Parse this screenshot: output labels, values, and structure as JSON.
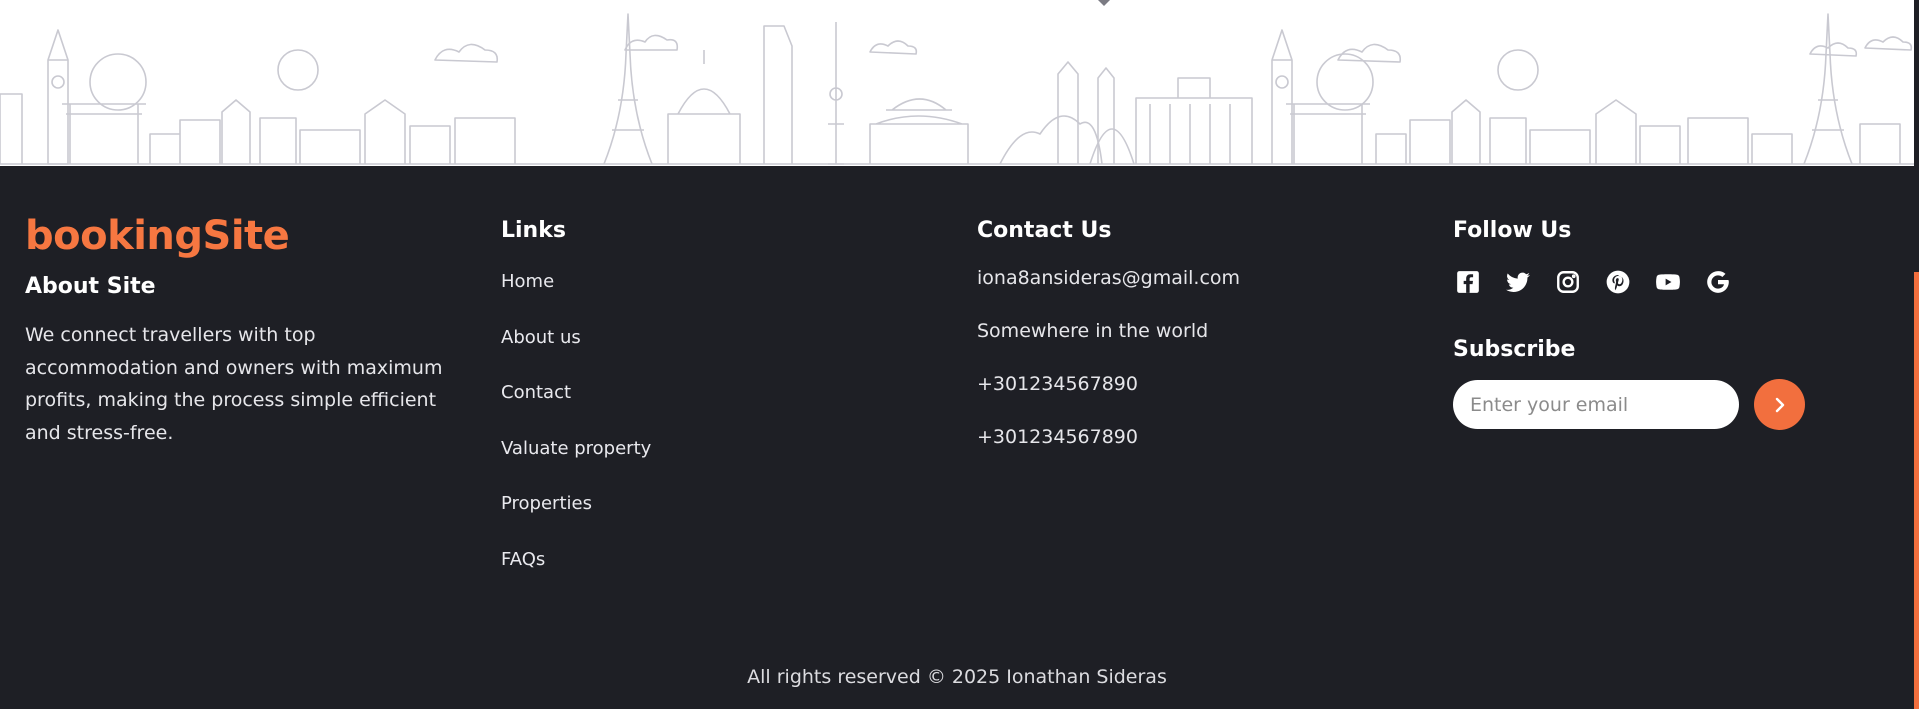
{
  "colors": {
    "accent": "#f26f3e",
    "brand": "#f67741",
    "footer_bg": "#1e1f25",
    "skyline_stroke": "#c9c9d1"
  },
  "footer": {
    "about": {
      "brand": "bookingSite",
      "heading": "About Site",
      "text": "We connect travellers with top accommodation and owners with maximum profits, making the process simple efficient and stress-free."
    },
    "links": {
      "heading": "Links",
      "items": [
        {
          "label": "Home"
        },
        {
          "label": "About us"
        },
        {
          "label": "Contact"
        },
        {
          "label": "Valuate property"
        },
        {
          "label": "Properties"
        },
        {
          "label": "FAQs"
        }
      ]
    },
    "contact": {
      "heading": "Contact Us",
      "email": "iona8ansideras@gmail.com",
      "address": "Somewhere in the world",
      "phone1": "+301234567890",
      "phone2": "+301234567890"
    },
    "follow": {
      "heading": "Follow Us",
      "icons": [
        "facebook-icon",
        "twitter-icon",
        "instagram-icon",
        "pinterest-icon",
        "youtube-icon",
        "google-icon"
      ]
    },
    "subscribe": {
      "heading": "Subscribe",
      "placeholder": "Enter your email",
      "value": "",
      "button_icon": "chevron-right-icon"
    },
    "copyright": "All rights reserved © 2025 Ionathan Sideras"
  }
}
